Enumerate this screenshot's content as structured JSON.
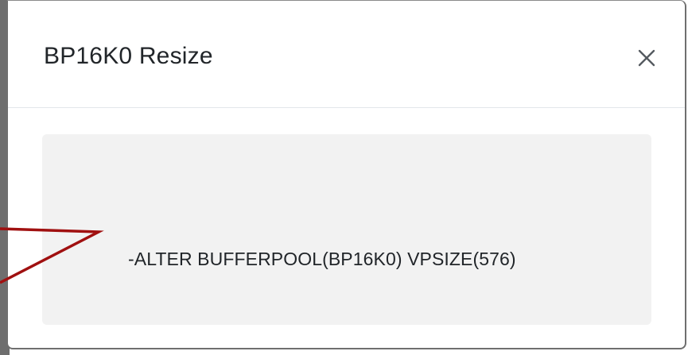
{
  "dialog": {
    "title": "BP16K0 Resize",
    "close_icon": "close-icon",
    "command": "-ALTER BUFFERPOOL(BP16K0) VPSIZE(576)"
  },
  "annotation": {
    "type": "callout-arrow",
    "color": "#a01010"
  },
  "colors": {
    "command_background": "#f2f2f2",
    "title_text": "#212529",
    "header_divider": "#e3e6ea"
  }
}
